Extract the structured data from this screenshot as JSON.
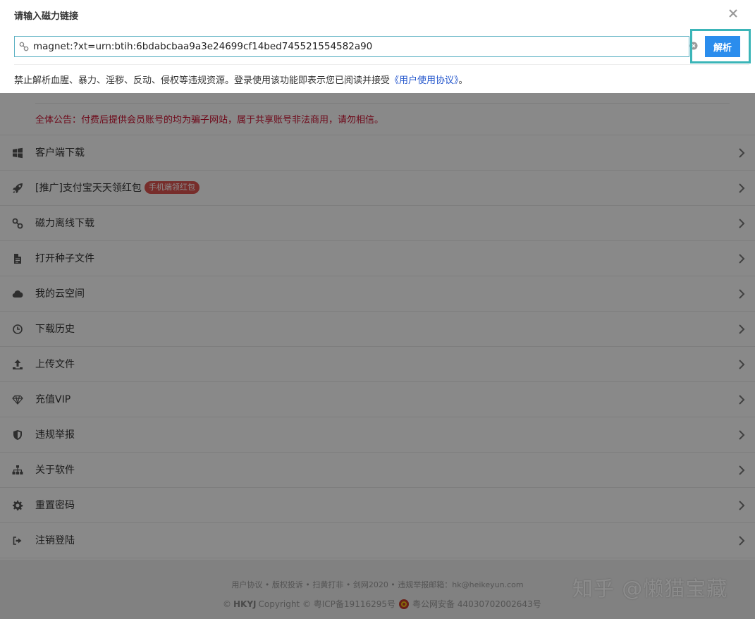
{
  "dialog": {
    "title": "请输入磁力链接",
    "input_value": "magnet:?xt=urn:btih:6bdabcbaa9a3e24699cf14bed745521554582a90",
    "parse_button": "解析",
    "disclaimer_prefix": "禁止解析血腥、暴力、淫秽、反动、侵权等违规资源。登录使用该功能即表示您已阅读并接受",
    "agreement_link": "《用户使用协议》",
    "disclaimer_suffix": "。"
  },
  "notice": "全体公告：付费后提供会员账号的均为骗子网站，属于共享账号非法商用，请勿相信。",
  "menu": [
    {
      "label": "客户端下载",
      "icon": "windows-icon"
    },
    {
      "label": "[推广]支付宝天天领红包",
      "icon": "rocket-icon",
      "badge": "手机端领红包"
    },
    {
      "label": "磁力离线下载",
      "icon": "link-icon"
    },
    {
      "label": "打开种子文件",
      "icon": "file-icon"
    },
    {
      "label": "我的云空间",
      "icon": "cloud-icon"
    },
    {
      "label": "下载历史",
      "icon": "clock-icon"
    },
    {
      "label": "上传文件",
      "icon": "upload-icon"
    },
    {
      "label": "充值VIP",
      "icon": "diamond-icon"
    },
    {
      "label": "违规举报",
      "icon": "shield-icon"
    },
    {
      "label": "关于软件",
      "icon": "sitemap-icon"
    },
    {
      "label": "重置密码",
      "icon": "gear-icon"
    },
    {
      "label": "注销登陆",
      "icon": "sign-out-icon"
    }
  ],
  "footer": {
    "links": "用户协议 • 版权投诉 • 扫黄打非 • 剑网2020 • 违规举报邮箱：hk@heikeyun.com",
    "copyright_prefix": "©",
    "brand": "HKYJ",
    "copyright_text": "Copyright © 粤ICP备19116295号",
    "police_text": "粤公网安备 44030702002643号"
  },
  "watermark": "知乎 @懒猫宝藏",
  "colors": {
    "accent": "#2b8ded",
    "highlight_border": "#3bb5b8",
    "notice_red": "#c8102e",
    "badge_red": "#d9534f",
    "link_blue": "#2255cc"
  }
}
